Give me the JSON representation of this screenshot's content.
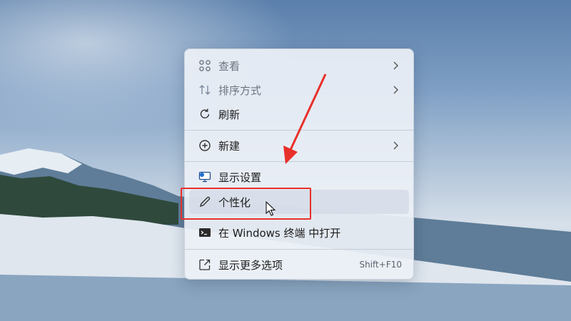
{
  "context_menu": {
    "items": [
      {
        "label": "查看",
        "icon": "grid-icon",
        "submenu": true
      },
      {
        "label": "排序方式",
        "icon": "sort-icon",
        "submenu": true
      },
      {
        "label": "刷新",
        "icon": "refresh-icon",
        "submenu": false
      },
      {
        "label": "新建",
        "icon": "plus-circle-icon",
        "submenu": true
      },
      {
        "label": "显示设置",
        "icon": "display-settings-icon",
        "submenu": false
      },
      {
        "label": "个性化",
        "icon": "pen-icon",
        "submenu": false
      },
      {
        "label": "在 Windows 终端 中打开",
        "icon": "terminal-icon",
        "submenu": false
      },
      {
        "label": "显示更多选项",
        "icon": "open-external-icon",
        "submenu": false,
        "shortcut": "Shift+F10"
      }
    ]
  },
  "annotation": {
    "highlight_color": "#e8302b",
    "highlighted_item": "个性化"
  }
}
